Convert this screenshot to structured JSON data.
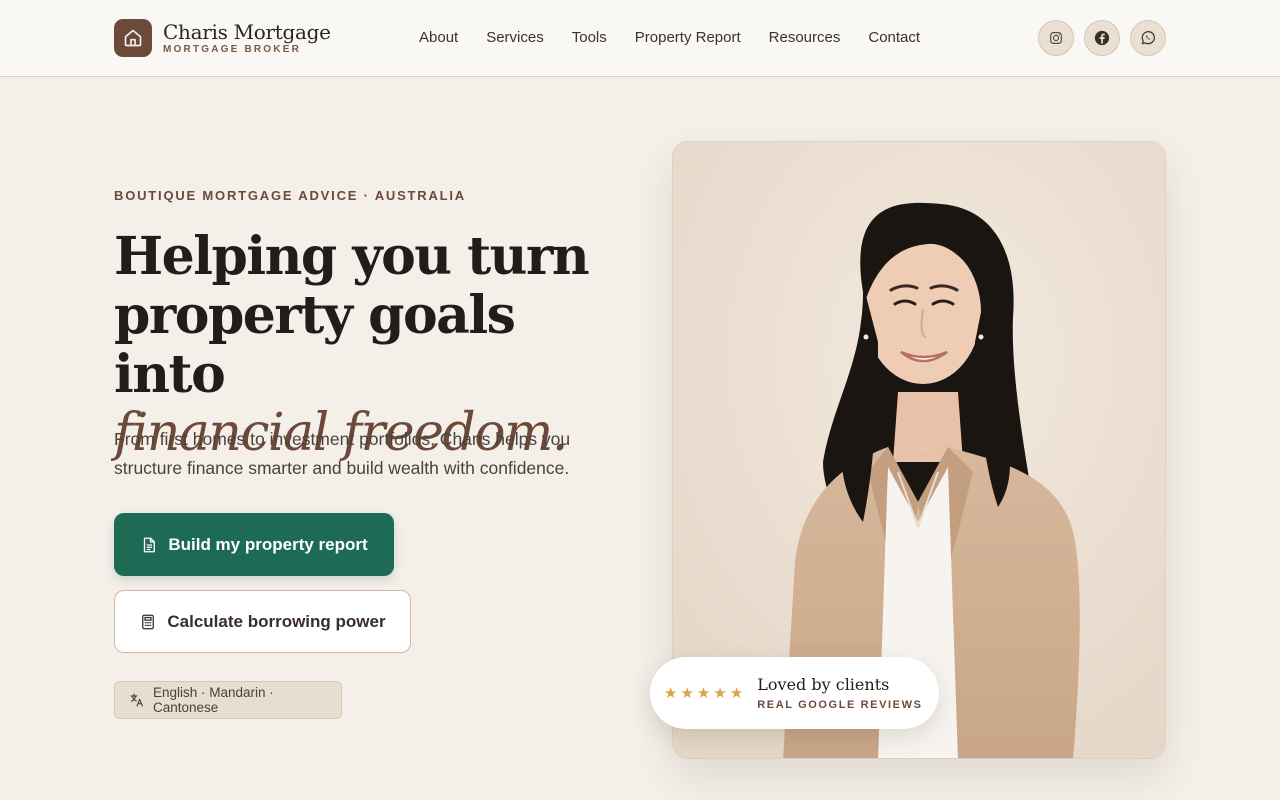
{
  "brand": {
    "name": "Charis Mortgage",
    "tagline": "MORTGAGE BROKER",
    "logo_icon": "house-icon"
  },
  "nav": {
    "items": [
      "About",
      "Services",
      "Tools",
      "Property Report",
      "Resources",
      "Contact"
    ]
  },
  "socials": [
    {
      "icon": "instagram-icon"
    },
    {
      "icon": "facebook-icon"
    },
    {
      "icon": "whatsapp-icon"
    }
  ],
  "hero": {
    "eyebrow": "BOUTIQUE MORTGAGE ADVICE · AUSTRALIA",
    "headline_line1": "Helping you turn",
    "headline_line2": "property goals into",
    "headline_accent": "financial freedom.",
    "lead": "From first homes to investment portfolios, Charis helps you structure finance smarter and build wealth with confidence.",
    "primary_cta": "Build my property report",
    "secondary_cta": "Calculate borrowing power",
    "languages": "English · Mandarin · Cantonese"
  },
  "review": {
    "rating": 5,
    "title": "Loved by clients",
    "subtitle": "REAL GOOGLE REVIEWS"
  },
  "colors": {
    "brand_brown": "#6b4a3a",
    "primary_green": "#1e6b55",
    "background": "#f4efe9",
    "star_gold": "#d9a441"
  }
}
